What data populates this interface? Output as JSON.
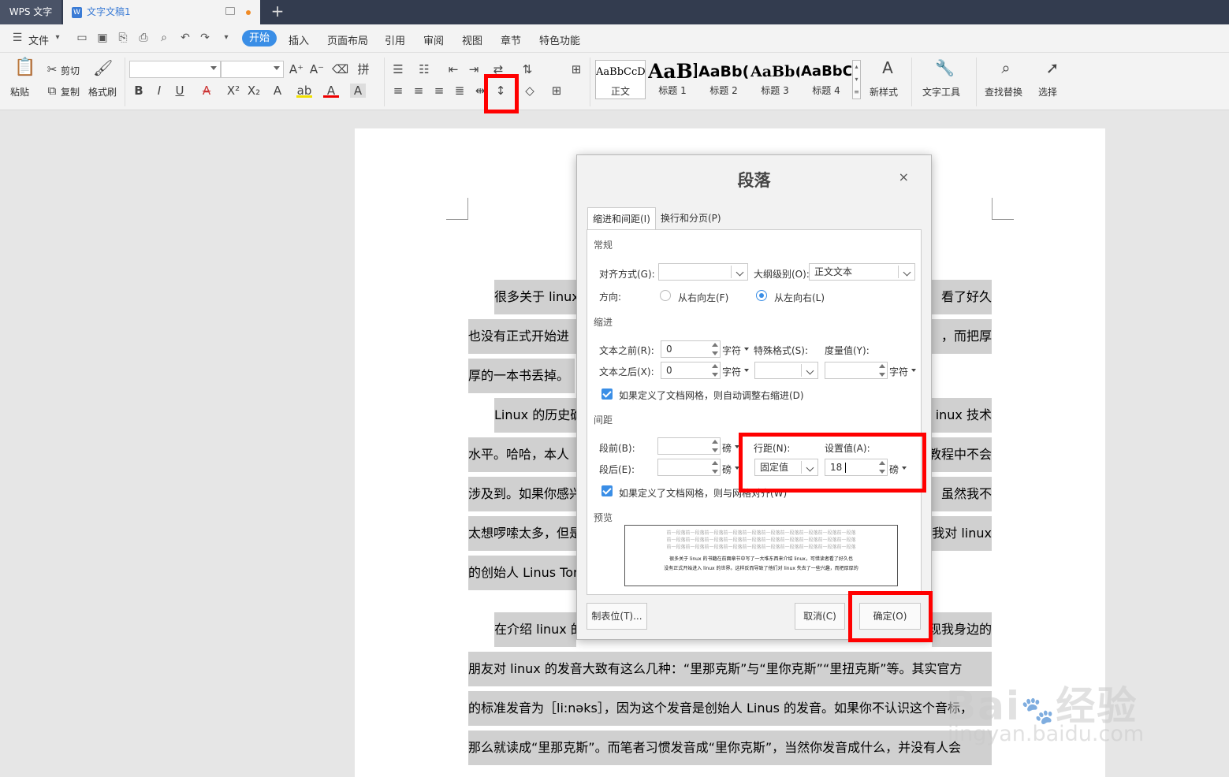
{
  "titlebar": {
    "app_tab": "WPS 文字",
    "doc_tab": "文字文稿1",
    "new_tab": "+"
  },
  "menu": {
    "file": "文件",
    "items": [
      "开始",
      "插入",
      "页面布局",
      "引用",
      "审阅",
      "视图",
      "章节",
      "特色功能"
    ]
  },
  "ribbon": {
    "paste": "粘贴",
    "cut": "剪切",
    "copy": "复制",
    "format_painter": "格式刷",
    "styles": [
      {
        "sample": "AaBbCcDd",
        "name": "正文"
      },
      {
        "sample": "AaBl",
        "name": "标题 1"
      },
      {
        "sample": "AaBb(",
        "name": "标题 2"
      },
      {
        "sample": "AaBb(",
        "name": "标题 3"
      },
      {
        "sample": "AaBbC",
        "name": "标题 4"
      }
    ],
    "new_style": "新样式",
    "text_tools": "文字工具",
    "find_replace": "查找替换",
    "select": "选择"
  },
  "document": {
    "lines": [
      {
        "left": "很多关于 linux",
        "right": "看了好久"
      },
      {
        "left": "也没有正式开始进",
        "right": "，而把厚"
      },
      {
        "left": "厚的一本书丢掉。",
        "right": ""
      },
      {
        "left": "Linux 的历史确",
        "right": "inux 技术"
      },
      {
        "left": "水平。哈哈，本人",
        "right": "教程中不会"
      },
      {
        "left": "涉及到。如果你感兴",
        "right": "虽然我不"
      },
      {
        "left": "太想啰嗦太多，但是",
        "right": "我对 linux"
      },
      {
        "left": "的创始人 Linus Tor",
        "right": ""
      },
      {
        "left": "在介绍 linux 的",
        "right": "现我身边的"
      }
    ],
    "full_lines": [
      "朋友对 linux 的发音大致有这么几种：“里那克斯”与“里你克斯”“里扭克斯”等。其实官方",
      "的标准发音为［li:nəks］，因为这个发音是创始人 Linus 的发音。如果你不认识这个音标，",
      "那么就读成“里那克斯”。而笔者习惯发音成“里你克斯”，当然你发音成什么，并没有人会"
    ]
  },
  "dialog": {
    "title": "段落",
    "close": "×",
    "tabs": [
      "缩进和间距(I)",
      "换行和分页(P)"
    ],
    "general": {
      "section": "常规",
      "alignment_label": "对齐方式(G):",
      "outline_label": "大纲级别(O):",
      "outline_value": "正文文本",
      "direction_label": "方向:",
      "rtl": "从右向左(F)",
      "ltr": "从左向右(L)"
    },
    "indent": {
      "section": "缩进",
      "before_label": "文本之前(R):",
      "before_value": "0",
      "before_unit": "字符",
      "after_label": "文本之后(X):",
      "after_value": "0",
      "after_unit": "字符",
      "special_label": "特殊格式(S):",
      "measure_label": "度量值(Y):",
      "measure_unit": "字符",
      "grid_check": "如果定义了文档网格，则自动调整右缩进(D)"
    },
    "spacing": {
      "section": "间距",
      "before_label": "段前(B):",
      "before_unit": "磅",
      "after_label": "段后(E):",
      "after_unit": "磅",
      "line_label": "行距(N):",
      "line_value": "固定值",
      "set_label": "设置值(A):",
      "set_value": "18",
      "set_unit": "磅",
      "grid_check": "如果定义了文档网格，则与网格对齐(W)"
    },
    "preview": {
      "section": "预览",
      "prev_line": "前一段落前一段落前一段落前一段落前一段落前一段落前一段落前一段落前一段落前一段落",
      "text1": "很多关于 linux 的书籍在前面章节中写了一大堆东西来介绍 linux，可惜读者看了好久也",
      "text2": "没有正式开始进入 linux 的世界。这样反而导致了他们对 linux 失去了一些兴趣，而把厚厚的"
    },
    "buttons": {
      "tabs": "制表位(T)...",
      "cancel": "取消(C)",
      "ok": "确定(O)"
    }
  },
  "watermark": {
    "brand": "Bai",
    "brand2": "经验",
    "url": "jingyan.baidu.com"
  }
}
